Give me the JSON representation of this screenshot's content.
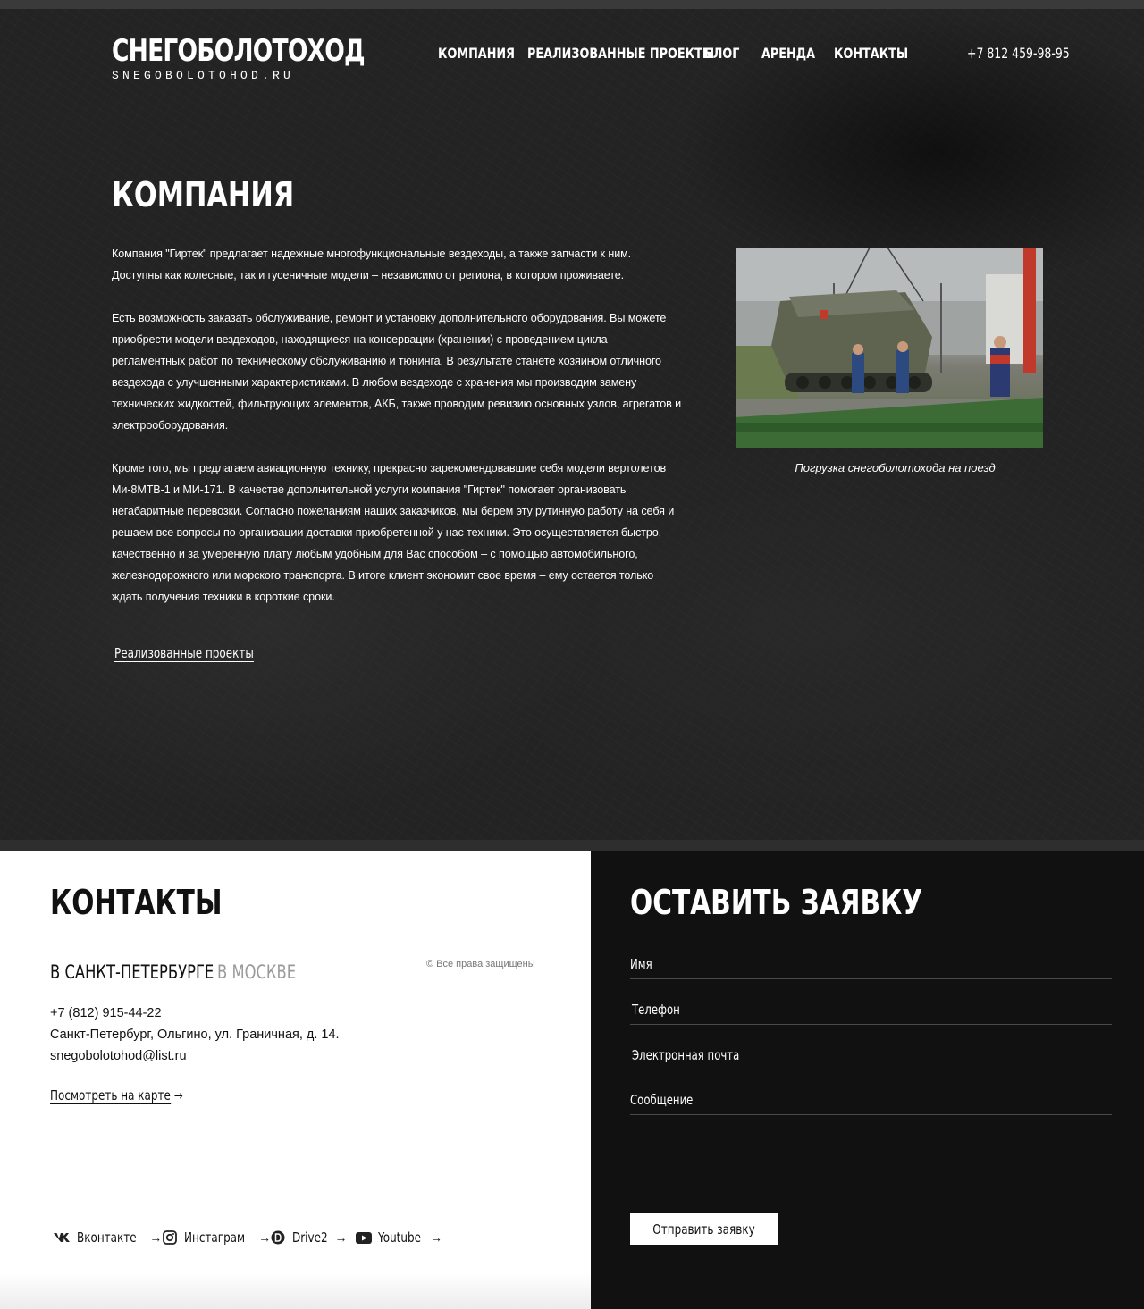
{
  "header": {
    "logo_main": "СНЕГОБОЛОТОХОД",
    "logo_sub": "SNEGOBOLOTOHOD.RU",
    "nav": [
      "КОМПАНИЯ",
      "РЕАЛИЗОВАННЫЕ ПРОЕКТЫ",
      "БЛОГ",
      "АРЕНДА",
      "КОНТАКТЫ"
    ],
    "phone": "+7 812 459-98-95"
  },
  "company": {
    "title": "КОМПАНИЯ",
    "paragraphs": [
      "Компания \"Гиртек\" предлагает надежные многофункциональные вездеходы, а также запчасти к ним. Доступны как колесные, так и гусеничные модели – независимо от региона, в котором проживаете.",
      "Есть возможность заказать обслуживание, ремонт и установку дополнительного оборудования. Вы можете приобрести модели вездеходов, находящиеся на консервации (хранении) с проведением цикла регламентных работ по техническому обслуживанию и тюнинга. В результате станете хозяином отличного вездехода с улучшенными характеристиками. В любом вездеходе с хранения мы производим замену технических жидкостей, фильтрующих элементов, АКБ, также проводим ревизию основных узлов, агрегатов и электрооборудования.",
      "Кроме того, мы предлагаем авиационную технику, прекрасно зарекомендовавшие себя модели вертолетов Ми-8МТВ-1 и МИ-171. В качестве дополнительной услуги компания \"Гиртек\" помогает организовать негабаритные перевозки. Согласно пожеланиям наших заказчиков, мы берем эту рутинную работу на себя и решаем все вопросы по организации доставки приобретенной у нас техники. Это осуществляется быстро, качественно и за умеренную плату любым удобным для Вас способом – с помощью автомобильного, железнодорожного или морского транспорта. В итоге клиент экономит свое время – ему остается только ждать получения техники в короткие сроки."
    ],
    "projects_link": "Реализованные проекты",
    "photo_caption": "Погрузка снегоболотохода на поезд"
  },
  "contacts": {
    "title": "КОНТАКТЫ",
    "tabs": [
      "В САНКТ-ПЕТЕРБУРГЕ",
      "В МОСКВЕ"
    ],
    "copyright": "© Все права защищены",
    "phone": "+7 (812) 915-44-22",
    "address": "Санкт-Петербург, Ольгино, ул. Граничная, д. 14.",
    "email": "snegobolotohod@list.ru",
    "map_link": "Посмотреть на карте",
    "arrow": "→",
    "social": [
      {
        "label": "Вконтакте",
        "icon": "vk-icon"
      },
      {
        "label": "Инстаграм",
        "icon": "instagram-icon"
      },
      {
        "label": "Drive2",
        "icon": "drive2-icon"
      },
      {
        "label": "Youtube",
        "icon": "youtube-icon"
      }
    ]
  },
  "request": {
    "title": "ОСТАВИТЬ ЗАЯВКУ",
    "fields": {
      "name": "Имя",
      "phone": "Телефон",
      "email": "Электронная почта",
      "message": "Сообщение"
    },
    "submit": "Отправить заявку"
  },
  "colors": {
    "hero_bg": "#232323",
    "contacts_bg": "#ffffff",
    "request_bg": "#111111",
    "text_light": "#ffffff",
    "text_dark": "#111111",
    "muted": "#9a9a9a"
  }
}
